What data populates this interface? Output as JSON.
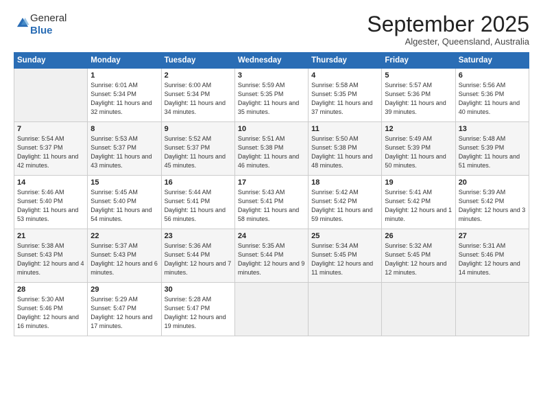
{
  "logo": {
    "general": "General",
    "blue": "Blue"
  },
  "header": {
    "month": "September 2025",
    "location": "Algester, Queensland, Australia"
  },
  "days_of_week": [
    "Sunday",
    "Monday",
    "Tuesday",
    "Wednesday",
    "Thursday",
    "Friday",
    "Saturday"
  ],
  "weeks": [
    [
      {
        "day": "",
        "empty": true
      },
      {
        "day": "1",
        "sunrise": "6:01 AM",
        "sunset": "5:34 PM",
        "daylight": "11 hours and 32 minutes."
      },
      {
        "day": "2",
        "sunrise": "6:00 AM",
        "sunset": "5:34 PM",
        "daylight": "11 hours and 34 minutes."
      },
      {
        "day": "3",
        "sunrise": "5:59 AM",
        "sunset": "5:35 PM",
        "daylight": "11 hours and 35 minutes."
      },
      {
        "day": "4",
        "sunrise": "5:58 AM",
        "sunset": "5:35 PM",
        "daylight": "11 hours and 37 minutes."
      },
      {
        "day": "5",
        "sunrise": "5:57 AM",
        "sunset": "5:36 PM",
        "daylight": "11 hours and 39 minutes."
      },
      {
        "day": "6",
        "sunrise": "5:56 AM",
        "sunset": "5:36 PM",
        "daylight": "11 hours and 40 minutes."
      }
    ],
    [
      {
        "day": "7",
        "sunrise": "5:54 AM",
        "sunset": "5:37 PM",
        "daylight": "11 hours and 42 minutes."
      },
      {
        "day": "8",
        "sunrise": "5:53 AM",
        "sunset": "5:37 PM",
        "daylight": "11 hours and 43 minutes."
      },
      {
        "day": "9",
        "sunrise": "5:52 AM",
        "sunset": "5:37 PM",
        "daylight": "11 hours and 45 minutes."
      },
      {
        "day": "10",
        "sunrise": "5:51 AM",
        "sunset": "5:38 PM",
        "daylight": "11 hours and 46 minutes."
      },
      {
        "day": "11",
        "sunrise": "5:50 AM",
        "sunset": "5:38 PM",
        "daylight": "11 hours and 48 minutes."
      },
      {
        "day": "12",
        "sunrise": "5:49 AM",
        "sunset": "5:39 PM",
        "daylight": "11 hours and 50 minutes."
      },
      {
        "day": "13",
        "sunrise": "5:48 AM",
        "sunset": "5:39 PM",
        "daylight": "11 hours and 51 minutes."
      }
    ],
    [
      {
        "day": "14",
        "sunrise": "5:46 AM",
        "sunset": "5:40 PM",
        "daylight": "11 hours and 53 minutes."
      },
      {
        "day": "15",
        "sunrise": "5:45 AM",
        "sunset": "5:40 PM",
        "daylight": "11 hours and 54 minutes."
      },
      {
        "day": "16",
        "sunrise": "5:44 AM",
        "sunset": "5:41 PM",
        "daylight": "11 hours and 56 minutes."
      },
      {
        "day": "17",
        "sunrise": "5:43 AM",
        "sunset": "5:41 PM",
        "daylight": "11 hours and 58 minutes."
      },
      {
        "day": "18",
        "sunrise": "5:42 AM",
        "sunset": "5:42 PM",
        "daylight": "11 hours and 59 minutes."
      },
      {
        "day": "19",
        "sunrise": "5:41 AM",
        "sunset": "5:42 PM",
        "daylight": "12 hours and 1 minute."
      },
      {
        "day": "20",
        "sunrise": "5:39 AM",
        "sunset": "5:42 PM",
        "daylight": "12 hours and 3 minutes."
      }
    ],
    [
      {
        "day": "21",
        "sunrise": "5:38 AM",
        "sunset": "5:43 PM",
        "daylight": "12 hours and 4 minutes."
      },
      {
        "day": "22",
        "sunrise": "5:37 AM",
        "sunset": "5:43 PM",
        "daylight": "12 hours and 6 minutes."
      },
      {
        "day": "23",
        "sunrise": "5:36 AM",
        "sunset": "5:44 PM",
        "daylight": "12 hours and 7 minutes."
      },
      {
        "day": "24",
        "sunrise": "5:35 AM",
        "sunset": "5:44 PM",
        "daylight": "12 hours and 9 minutes."
      },
      {
        "day": "25",
        "sunrise": "5:34 AM",
        "sunset": "5:45 PM",
        "daylight": "12 hours and 11 minutes."
      },
      {
        "day": "26",
        "sunrise": "5:32 AM",
        "sunset": "5:45 PM",
        "daylight": "12 hours and 12 minutes."
      },
      {
        "day": "27",
        "sunrise": "5:31 AM",
        "sunset": "5:46 PM",
        "daylight": "12 hours and 14 minutes."
      }
    ],
    [
      {
        "day": "28",
        "sunrise": "5:30 AM",
        "sunset": "5:46 PM",
        "daylight": "12 hours and 16 minutes."
      },
      {
        "day": "29",
        "sunrise": "5:29 AM",
        "sunset": "5:47 PM",
        "daylight": "12 hours and 17 minutes."
      },
      {
        "day": "30",
        "sunrise": "5:28 AM",
        "sunset": "5:47 PM",
        "daylight": "12 hours and 19 minutes."
      },
      {
        "day": "",
        "empty": true
      },
      {
        "day": "",
        "empty": true
      },
      {
        "day": "",
        "empty": true
      },
      {
        "day": "",
        "empty": true
      }
    ]
  ],
  "labels": {
    "sunrise_prefix": "Sunrise: ",
    "sunset_prefix": "Sunset: ",
    "daylight_prefix": "Daylight: "
  }
}
